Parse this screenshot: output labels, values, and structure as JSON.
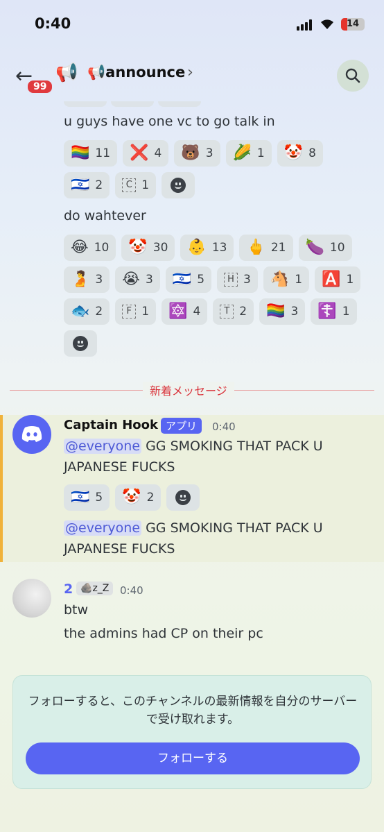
{
  "status": {
    "time": "0:40",
    "battery": "14"
  },
  "header": {
    "back_badge": "99",
    "channel_icon": "megaphone-icon",
    "channel_name": "📢announce",
    "chevron": "›"
  },
  "messages": [
    {
      "text": "u guys have one vc to go talk in",
      "reactions": [
        {
          "emoji": "🏳️‍🌈",
          "count": "11"
        },
        {
          "emoji": "❌",
          "count": "4"
        },
        {
          "emoji": "🐻",
          "count": "3"
        },
        {
          "emoji": "🌽",
          "count": "1"
        },
        {
          "emoji": "🤡",
          "count": "8"
        },
        {
          "emoji": "🇮🇱",
          "count": "2"
        },
        {
          "emoji": "C",
          "count": "1"
        }
      ]
    },
    {
      "text": "do wahtever",
      "reactions": [
        {
          "emoji": "😂",
          "count": "10"
        },
        {
          "emoji": "🤡",
          "count": "30"
        },
        {
          "emoji": "👶",
          "count": "13"
        },
        {
          "emoji": "🖕",
          "count": "21"
        },
        {
          "emoji": "🍆",
          "count": "10"
        },
        {
          "emoji": "🫄",
          "count": "3"
        },
        {
          "emoji": "😭",
          "count": "3"
        },
        {
          "emoji": "🇮🇱",
          "count": "5"
        },
        {
          "emoji": "H",
          "count": "3"
        },
        {
          "emoji": "🐴",
          "count": "1"
        },
        {
          "emoji": "🅰️",
          "count": "1"
        },
        {
          "emoji": "🐟",
          "count": "2"
        },
        {
          "emoji": "F",
          "count": "1"
        },
        {
          "emoji": "🔯",
          "count": "4"
        },
        {
          "emoji": "T",
          "count": "2"
        },
        {
          "emoji": "🏳️‍🌈",
          "count": "3"
        },
        {
          "emoji": "☦️",
          "count": "1"
        }
      ]
    }
  ],
  "divider": "新着メッセージ",
  "hook": {
    "author": "Captain Hook",
    "tag": "アプリ",
    "time": "0:40",
    "mention": "@everyone",
    "line1": " GG SMOKING THAT PACK U",
    "line2": "JAPANESE FUCKS",
    "reactions": [
      {
        "emoji": "🇮🇱",
        "count": "5"
      },
      {
        "emoji": "🤡",
        "count": "2"
      }
    ]
  },
  "user2": {
    "name": "2",
    "tag": "z_Z",
    "time": "0:40",
    "line1": "btw",
    "line2": "the admins had CP on their pc"
  },
  "follow": {
    "text": "フォローすると、このチャンネルの最新情報を自分のサーバーで受け取れます。",
    "button": "フォローする"
  }
}
